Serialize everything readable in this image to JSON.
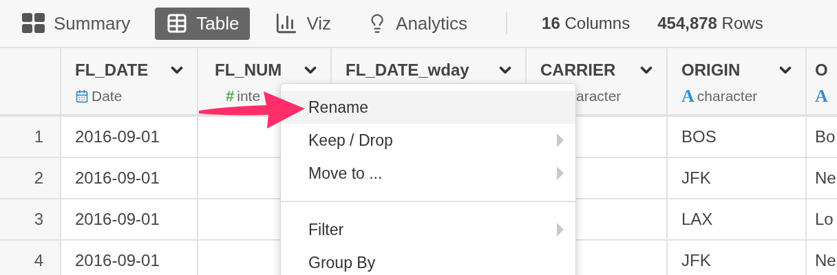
{
  "tabs": [
    {
      "label": "Summary",
      "kind": "summary",
      "selected": false
    },
    {
      "label": "Table",
      "kind": "table",
      "selected": true
    },
    {
      "label": "Viz",
      "kind": "viz",
      "selected": false
    },
    {
      "label": "Analytics",
      "kind": "analytics",
      "selected": false
    }
  ],
  "stats": [
    "**16** Columns",
    "**454,878** Rows"
  ],
  "table": {
    "columns": [
      {
        "name": "FL_DATE",
        "kind": "date",
        "type": "Date"
      },
      {
        "name": "FL_NUM",
        "kind": "integer",
        "icon": "#",
        "type": "inte"
      },
      {
        "name": "FL_DATE_wday"
      },
      {
        "name": "CARRIER",
        "kind": "character",
        "type": "aracter"
      },
      {
        "name": "ORIGIN",
        "kind": "character",
        "icon": "A",
        "type": "character"
      },
      {
        "name": "O",
        "kind": "character",
        "icon": "A"
      }
    ],
    "rows": [
      {
        "number": "1",
        "fl_date": "2016-09-01",
        "origin": "BOS",
        "column_7": "Bo"
      },
      {
        "number": "2",
        "fl_date": "2016-09-01",
        "origin": "JFK",
        "column_7": "Ne"
      },
      {
        "number": "3",
        "fl_date": "2016-09-01",
        "origin": "LAX",
        "column_7": "Lo"
      },
      {
        "number": "4",
        "fl_date": "2016-09-01",
        "origin": "JFK",
        "column_7": "Ne"
      }
    ]
  },
  "context_menu": {
    "items": [
      {
        "kind": "item",
        "label": "Rename",
        "selected": true,
        "submenu": false
      },
      {
        "kind": "item",
        "label": "Keep / Drop",
        "selected": false,
        "submenu": true
      },
      {
        "kind": "item",
        "label": "Move to ...",
        "selected": false,
        "submenu": true
      },
      {
        "kind": "separator"
      },
      {
        "kind": "item",
        "label": "Filter",
        "selected": false,
        "submenu": true
      },
      {
        "kind": "item",
        "label": "Group By",
        "selected": false,
        "submenu": false
      }
    ]
  }
}
